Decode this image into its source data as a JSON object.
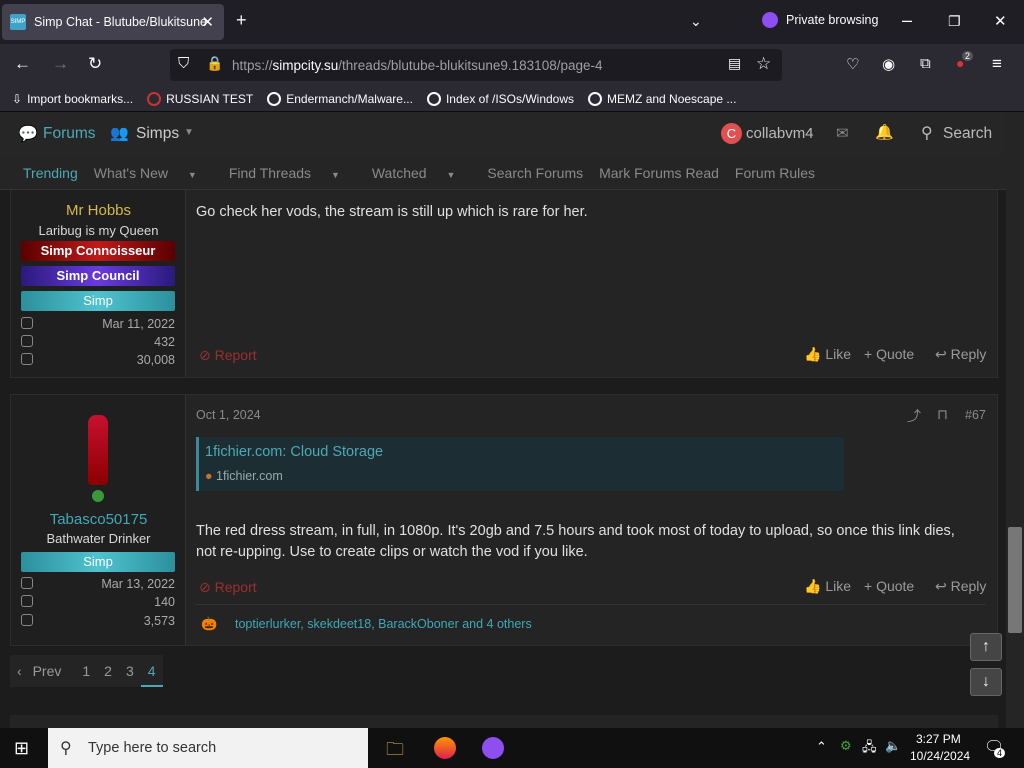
{
  "browser": {
    "tab_title": "Simp Chat - Blutube/Blukitsune",
    "private_label": "Private browsing",
    "url_prefix": "https://",
    "url_host": "simpcity.su",
    "url_path": "/threads/blutube-blukitsune9.183108/page-4",
    "extensions_badge": "2",
    "bookmarks": [
      "Import bookmarks...",
      "RUSSIAN TEST",
      "Endermanch/Malware...",
      "Index of /ISOs/Windows",
      "MEMZ and Noescape ..."
    ]
  },
  "forum": {
    "nav_forums": "Forums",
    "nav_simps": "Simps",
    "user_initial": "C",
    "user_name": "collabvm4",
    "search_label": "Search",
    "subnav": [
      "Trending",
      "What's New",
      "Find Threads",
      "Watched",
      "Search Forums",
      "Mark Forums Read",
      "Forum Rules"
    ]
  },
  "post1": {
    "username": "Mr Hobbs",
    "title": "Laribug is my Queen",
    "banners": [
      "Simp Connoisseur",
      "Simp Council",
      "Simp"
    ],
    "joined": "Mar 11, 2022",
    "messages": "432",
    "reactions": "30,008",
    "message": "Go check her vods, the stream is still up which is rare for her.",
    "report": "Report",
    "like": "Like",
    "quote": "+ Quote",
    "reply": "Reply"
  },
  "post2": {
    "date": "Oct 1, 2024",
    "post_number": "#67",
    "username": "Tabasco50175",
    "title": "Bathwater Drinker",
    "banner": "Simp",
    "joined": "Mar 13, 2022",
    "messages": "140",
    "reactions": "3,573",
    "link_title": "1fichier.com: Cloud Storage",
    "link_host": "1fichier.com",
    "message_line1": "The red dress stream, in full, in 1080p. It's 20gb and 7.5 hours and took most of today to upload, so once this link dies,",
    "message_line2": "not re-upping. Use to create clips or watch the vod if you like.",
    "report": "Report",
    "like": "Like",
    "quote": "+ Quote",
    "reply": "Reply",
    "reactions_list": "toptierlurker, skekdeet18, BarackOboner and 4 others"
  },
  "pager": {
    "prev": "Prev",
    "pages": [
      "1",
      "2",
      "3",
      "4"
    ],
    "current": "4"
  },
  "taskbar": {
    "search_placeholder": "Type here to search",
    "time": "3:27 PM",
    "date": "10/24/2024",
    "notif_count": "4"
  },
  "colors": {
    "accent": "#4fa8b6",
    "username_gold": "#d8b84a",
    "username_teal": "#3fa9b6",
    "report_red": "#9b2f2f"
  }
}
